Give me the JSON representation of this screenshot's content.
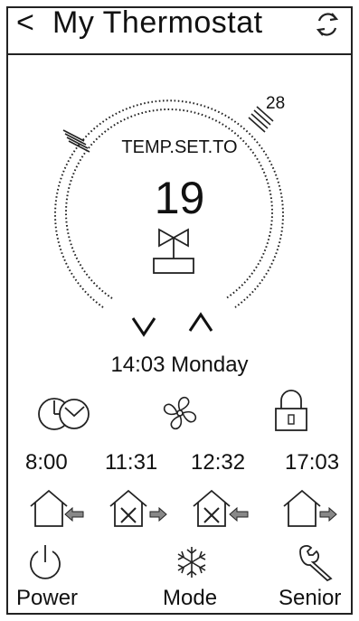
{
  "header": {
    "back_symbol": "<",
    "title": "My Thermostat",
    "refresh_icon": "refresh-icon"
  },
  "dial": {
    "set_label": "TEMP.SET.TO",
    "set_value": "19",
    "max_label": "28",
    "down_symbol": "V",
    "up_symbol": "^",
    "mode_icon": "fan-valve-icon"
  },
  "status": {
    "datetime": "14:03 Monday"
  },
  "quick_icons": [
    {
      "name": "schedule-clock-icon"
    },
    {
      "name": "fan-icon"
    },
    {
      "name": "lock-icon"
    }
  ],
  "schedule": [
    {
      "time": "8:00",
      "icon": "leave-home-icon"
    },
    {
      "time": "11:31",
      "icon": "return-home-tools-icon"
    },
    {
      "time": "12:32",
      "icon": "leave-home-tools-icon"
    },
    {
      "time": "17:03",
      "icon": "return-home-icon"
    }
  ],
  "bottom_buttons": [
    {
      "label": "Power",
      "icon": "power-icon"
    },
    {
      "label": "Mode",
      "icon": "snowflake-icon"
    },
    {
      "label": "Senior",
      "icon": "wrench-icon"
    }
  ]
}
